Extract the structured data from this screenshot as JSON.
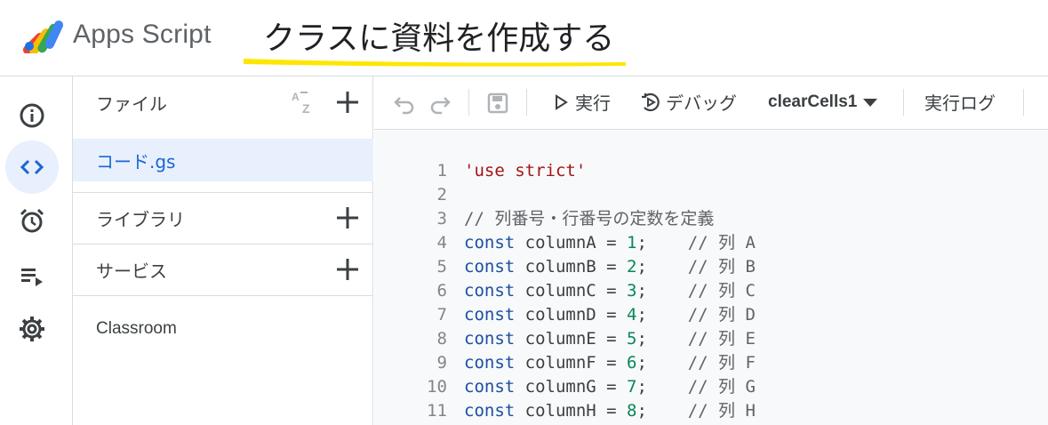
{
  "header": {
    "app_name": "Apps Script",
    "project_title": "クラスに資料を作成する",
    "highlight_color": "#ffe600"
  },
  "rail": {
    "items": [
      {
        "icon": "info-icon"
      },
      {
        "icon": "code-brackets-icon",
        "active": true
      },
      {
        "icon": "alarm-clock-icon"
      },
      {
        "icon": "executions-list-icon"
      },
      {
        "icon": "gear-icon"
      }
    ]
  },
  "files": {
    "files_label": "ファイル",
    "files_sort_icon": "AZ",
    "active_file": "コード.gs",
    "libraries_label": "ライブラリ",
    "services_label": "サービス",
    "service_item": "Classroom"
  },
  "toolbar": {
    "run_label": "実行",
    "debug_label": "デバッグ",
    "function_name": "clearCells1",
    "log_label": "実行ログ"
  },
  "editor": {
    "lines": [
      {
        "n": "1",
        "t": "'use strict'"
      },
      {
        "n": "2",
        "t": ""
      },
      {
        "n": "3",
        "t": "// 列番号・行番号の定数を定義"
      },
      {
        "n": "4",
        "kw": "const",
        "var": "columnA",
        "num": "1",
        "cm": "// 列 A"
      },
      {
        "n": "5",
        "kw": "const",
        "var": "columnB",
        "num": "2",
        "cm": "// 列 B"
      },
      {
        "n": "6",
        "kw": "const",
        "var": "columnC",
        "num": "3",
        "cm": "// 列 C"
      },
      {
        "n": "7",
        "kw": "const",
        "var": "columnD",
        "num": "4",
        "cm": "// 列 D"
      },
      {
        "n": "8",
        "kw": "const",
        "var": "columnE",
        "num": "5",
        "cm": "// 列 E"
      },
      {
        "n": "9",
        "kw": "const",
        "var": "columnF",
        "num": "6",
        "cm": "// 列 F"
      },
      {
        "n": "10",
        "kw": "const",
        "var": "columnG",
        "num": "7",
        "cm": "// 列 G"
      },
      {
        "n": "11",
        "kw": "const",
        "var": "columnH",
        "num": "8",
        "cm": "// 列 H"
      }
    ]
  }
}
